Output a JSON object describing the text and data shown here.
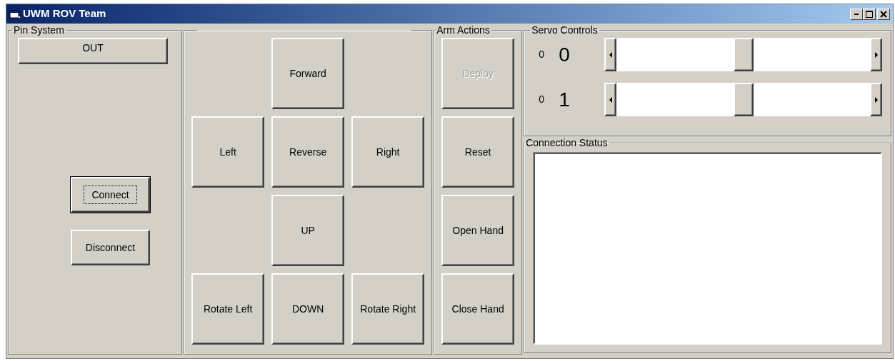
{
  "window": {
    "title": "UWM ROV Team"
  },
  "pin_system": {
    "title": "Pin System",
    "out_button": "OUT",
    "buttons": [
      {
        "label": "Connect",
        "focused": true
      },
      {
        "label": "Disconnect",
        "focused": false
      }
    ]
  },
  "movement": {
    "rows": [
      {
        "center": "Forward"
      },
      {
        "left": "Left",
        "center": "Reverse",
        "right": "Right"
      },
      {
        "center": "UP"
      },
      {
        "left": "Rotate Left",
        "center": "DOWN",
        "right": "Rotate Right"
      }
    ]
  },
  "arm_actions": {
    "title": "Arm Actions",
    "buttons": [
      {
        "label": "Deploy",
        "disabled": true
      },
      {
        "label": "Reset",
        "disabled": false
      },
      {
        "label": "Open Hand",
        "disabled": false
      },
      {
        "label": "Close Hand",
        "disabled": false
      }
    ]
  },
  "servo_controls": {
    "title": "Servo Controls",
    "servos": [
      {
        "reading": "0",
        "label": "0",
        "level": 0.5
      },
      {
        "reading": "0",
        "label": "1",
        "level": 0.5
      }
    ]
  },
  "connection_status": {
    "title": "Connection Status"
  }
}
